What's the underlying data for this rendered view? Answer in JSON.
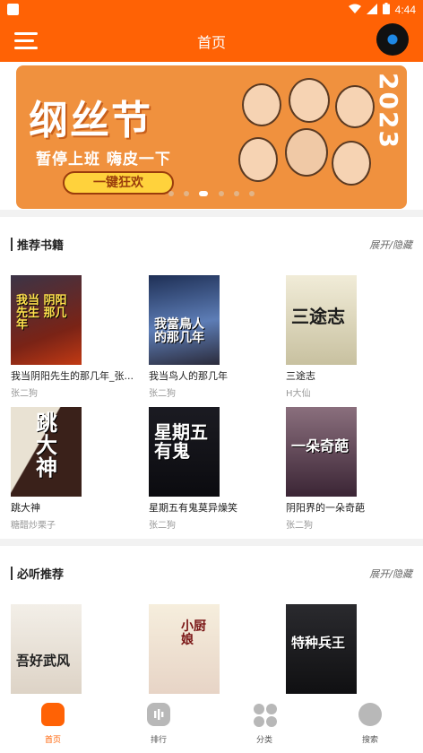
{
  "status": {
    "time": "4:44"
  },
  "appbar": {
    "title": "首页",
    "menu_icon": "menu-icon",
    "player_icon": "vinyl-disc-icon"
  },
  "banner": {
    "logo_text": "纲丝节",
    "slogan": "暂停上班 嗨皮一下",
    "cta": "一键狂欢",
    "year": "2023",
    "page_count": 6,
    "active_page": 3
  },
  "sections": [
    {
      "title": "推荐书籍",
      "toggle": "展开/隐藏",
      "books": [
        {
          "name": "我当阴阳先生的那几年_张...",
          "author": "张二狗",
          "cover_text": "我当 阴阳先生 那几年",
          "cover_color": "#5a2a1f"
        },
        {
          "name": "我当鸟人的那几年",
          "author": "张二狗",
          "cover_text": "我當鳥人 的那几年",
          "cover_color": "#273a5c"
        },
        {
          "name": "三途志",
          "author": "H大仙",
          "cover_text": "三途志",
          "cover_color": "#d9d2b4"
        },
        {
          "name": "跳大神",
          "author": "糖醋炒栗子",
          "cover_text": "跳 大 神",
          "cover_color": "#2a1c18"
        },
        {
          "name": "星期五有鬼莫异燥笑",
          "author": "张二狗",
          "cover_text": "星期五 有鬼",
          "cover_color": "#0e0e12"
        },
        {
          "name": "阴阳界的一朵奇葩",
          "author": "张二狗",
          "cover_text": "一朵奇葩",
          "cover_color": "#3c2c3c"
        }
      ]
    },
    {
      "title": "必听推荐",
      "toggle": "展开/隐藏",
      "books": [
        {
          "name": "",
          "author": "",
          "cover_text": "吾好武风",
          "cover_color": "#ece6df"
        },
        {
          "name": "",
          "author": "",
          "cover_text": "小厨娘",
          "cover_color": "#f1e8d8"
        },
        {
          "name": "",
          "author": "",
          "cover_text": "特种兵王",
          "cover_color": "#1c1c20"
        }
      ]
    }
  ],
  "tabbar": [
    {
      "label": "首页",
      "icon": "home-icon",
      "active": true
    },
    {
      "label": "排行",
      "icon": "ranking-icon",
      "active": false
    },
    {
      "label": "分类",
      "icon": "category-grid-icon",
      "active": false
    },
    {
      "label": "搜索",
      "icon": "search-icon",
      "active": false
    }
  ],
  "colors": {
    "accent": "#ff6205",
    "banner": "#f0913e"
  }
}
